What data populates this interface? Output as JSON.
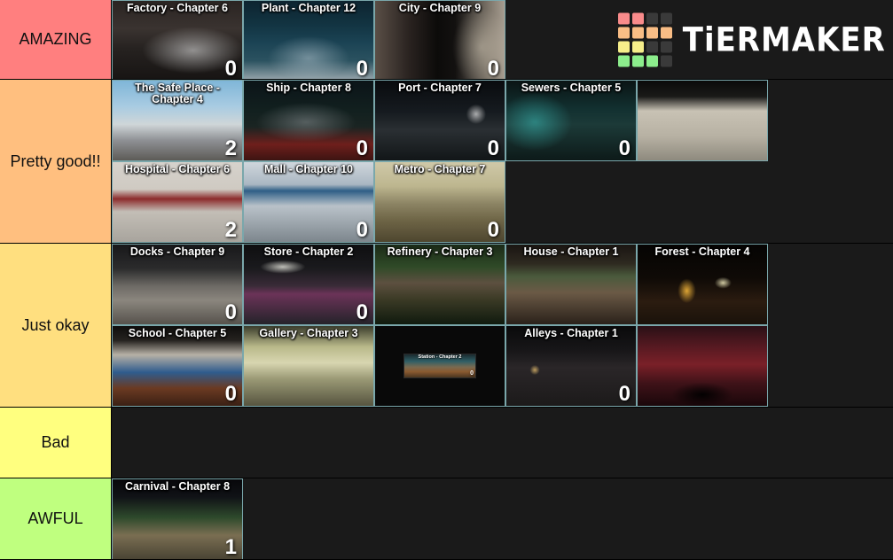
{
  "app": {
    "name": "TierMaker",
    "logo_text": "TiERMAKER",
    "logo_grid": [
      [
        "#f98b8b",
        "#f98b8b",
        "#3a3a3a",
        "#3a3a3a"
      ],
      [
        "#f9bd85",
        "#f9bd85",
        "#f9bd85",
        "#f9bd85"
      ],
      [
        "#f6ee8a",
        "#f6ee8a",
        "#3a3a3a",
        "#3a3a3a"
      ],
      [
        "#8ced8c",
        "#8ced8c",
        "#8ced8c",
        "#3a3a3a"
      ]
    ]
  },
  "colors": {
    "background": "#1a1a1a",
    "tile_border": "#a0dce1",
    "label_text": "#111111"
  },
  "tiers": [
    {
      "label": "AMAZING",
      "color": "#ff7f7f",
      "items": [
        {
          "title": "Factory - Chapter 6",
          "badge": "0",
          "art": "art-factory",
          "wrap": true
        },
        {
          "title": "Plant - Chapter 12",
          "badge": "0",
          "art": "art-plant",
          "wrap": false
        },
        {
          "title": "City - Chapter 9",
          "badge": "0",
          "art": "art-city",
          "wrap": false
        }
      ]
    },
    {
      "label": "Pretty good!!",
      "color": "#ffbf7f",
      "items": [
        {
          "title": "The Safe Place - Chapter 4",
          "badge": "2",
          "art": "art-safeplace",
          "wrap": true
        },
        {
          "title": "Ship - Chapter 8",
          "badge": "0",
          "art": "art-ship",
          "wrap": false
        },
        {
          "title": "Port - Chapter 7",
          "badge": "0",
          "art": "art-port",
          "wrap": false
        },
        {
          "title": "Sewers - Chapter 5",
          "badge": "0",
          "art": "art-sewers",
          "wrap": false
        },
        {
          "title": "",
          "badge": "",
          "art": "art-hall",
          "wrap": false
        },
        {
          "title": "Hospital - Chapter 6",
          "badge": "2",
          "art": "art-hospital",
          "wrap": false
        },
        {
          "title": "Mall - Chapter 10",
          "badge": "0",
          "art": "art-mall",
          "wrap": false
        },
        {
          "title": "Metro - Chapter 7",
          "badge": "0",
          "art": "art-metro",
          "wrap": true
        }
      ]
    },
    {
      "label": "Just okay",
      "color": "#ffdf7f",
      "items": [
        {
          "title": "Docks - Chapter 9",
          "badge": "0",
          "art": "art-docks",
          "wrap": false
        },
        {
          "title": "Store - Chapter 2",
          "badge": "0",
          "art": "art-store",
          "wrap": false
        },
        {
          "title": "Refinery - Chapter 3",
          "badge": "",
          "art": "art-refinery",
          "wrap": false
        },
        {
          "title": "House - Chapter 1",
          "badge": "",
          "art": "art-house",
          "wrap": false
        },
        {
          "title": "Forest - Chapter 4",
          "badge": "",
          "art": "art-forest",
          "wrap": false
        },
        {
          "title": "School - Chapter 5",
          "badge": "0",
          "art": "art-school",
          "wrap": false
        },
        {
          "title": "Gallery - Chapter 3",
          "badge": "",
          "art": "art-gallery",
          "wrap": false
        },
        {
          "title": "Station - Chapter 2",
          "badge": "0",
          "art": "art-station",
          "wrap": false,
          "thumb": true
        },
        {
          "title": "Alleys - Chapter 1",
          "badge": "0",
          "art": "art-alleys",
          "wrap": false
        },
        {
          "title": "",
          "badge": "",
          "art": "art-crimson",
          "wrap": false
        }
      ]
    },
    {
      "label": "Bad",
      "color": "#ffff7f",
      "items": []
    },
    {
      "label": "AWFUL",
      "color": "#bfff7f",
      "items": [
        {
          "title": "Carnival - Chapter 8",
          "badge": "1",
          "art": "art-carnival",
          "wrap": true
        }
      ]
    }
  ]
}
